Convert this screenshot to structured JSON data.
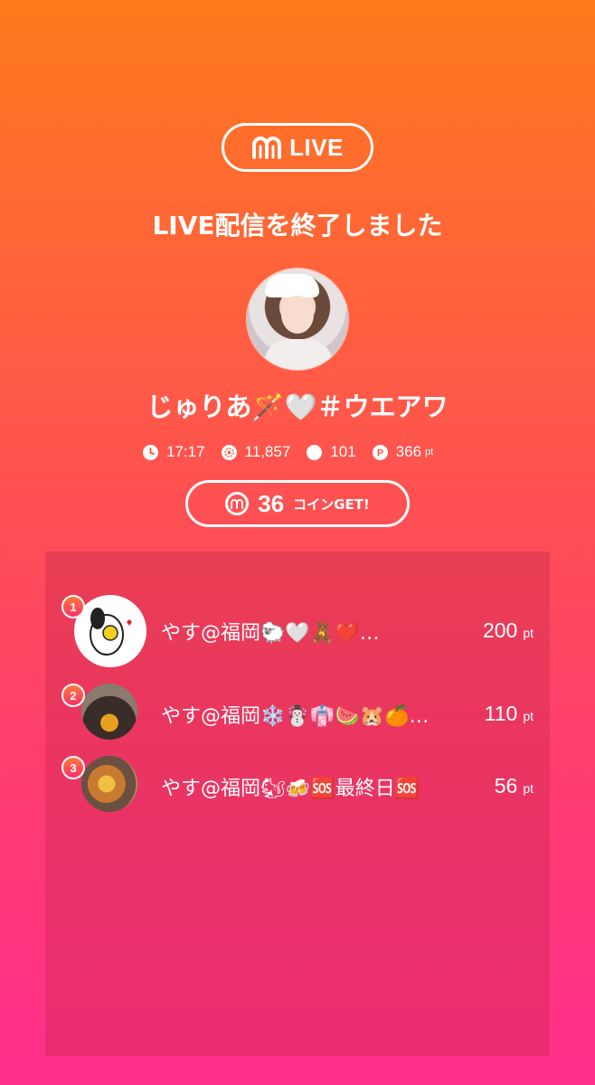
{
  "header": {
    "brand_label": "LIVE",
    "title": "LIVE配信を終了しました"
  },
  "broadcaster": {
    "name": "じゅりあ🪄🤍＃ウエアワ"
  },
  "stats": {
    "time": "17:17",
    "views": "11,857",
    "comments": "101",
    "points": "366",
    "points_unit": "pt"
  },
  "coins": {
    "amount": "36",
    "label": "コインGET!"
  },
  "ranking": [
    {
      "rank": "1",
      "name": "やす@福岡🐑🤍🧸❤️…",
      "points": "200",
      "unit": "pt"
    },
    {
      "rank": "2",
      "name": "やす@福岡❄️☃️👘🍉🐹🍊…",
      "points": "110",
      "unit": "pt"
    },
    {
      "rank": "3",
      "name": "やす@福岡🐿🍻🆘最終日🆘",
      "points": "56",
      "unit": "pt"
    }
  ],
  "colors": {
    "gradient_top": "#ff7a1c",
    "gradient_bottom": "#ff2e8c",
    "text": "#ffffff"
  }
}
